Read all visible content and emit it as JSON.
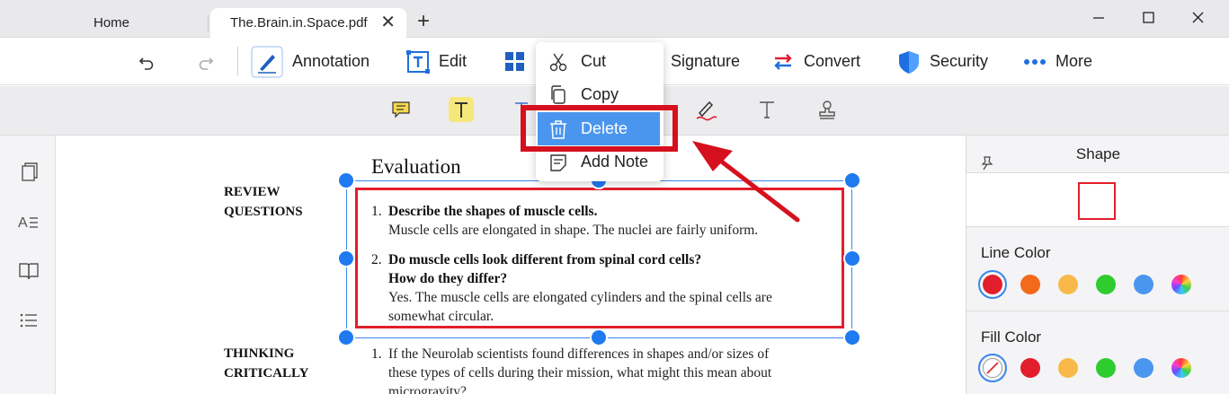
{
  "tabs": {
    "home": "Home",
    "active": "The.Brain.in.Space.pdf",
    "add": "+"
  },
  "window": {
    "minimize": "—",
    "maximize": "☐",
    "close": "✕"
  },
  "toolbar": {
    "undo_icon": "undo-icon",
    "redo_icon": "redo-icon",
    "annotation": "Annotation",
    "edit": "Edit",
    "signature": "Signature",
    "convert": "Convert",
    "security": "Security",
    "more": "More"
  },
  "subtoolbar": {
    "icons": [
      "comment-icon",
      "highlight-text-icon",
      "underline-icon",
      "pen-icon",
      "text-icon",
      "stamp-icon"
    ]
  },
  "context_menu": {
    "items": [
      {
        "label": "Cut",
        "icon": "scissors-icon"
      },
      {
        "label": "Copy",
        "icon": "copy-icon"
      },
      {
        "label": "Delete",
        "icon": "trash-icon"
      },
      {
        "label": "Add Note",
        "icon": "note-icon"
      }
    ],
    "active_item": "Delete"
  },
  "document": {
    "heading": "Evaluation",
    "section1": "REVIEW QUESTIONS",
    "section1_line1": "REVIEW",
    "section1_line2": "QUESTIONS",
    "section2_line1": "THINKING",
    "section2_line2": "CRITICALLY",
    "questions": [
      {
        "num": "1.",
        "q": "Describe the shapes of muscle cells.",
        "a": "Muscle cells are elongated in shape. The nuclei are fairly uniform."
      },
      {
        "num": "2.",
        "q1": "Do muscle cells look different from spinal cord cells?",
        "q2": "How do they differ?",
        "a1": "Yes. The muscle cells are elongated cylinders and the spinal cells are",
        "a2": "somewhat circular."
      }
    ],
    "thinking": {
      "num": "1.",
      "l1": "If the Neurolab scientists found differences in shapes and/or sizes of",
      "l2": "these types of cells during their mission, what might this mean about",
      "l3": "microgravity?"
    }
  },
  "panel": {
    "title": "Shape",
    "line_color_label": "Line Color",
    "fill_color_label": "Fill Color",
    "line_colors": [
      "#e21e2c",
      "#f26a1b",
      "#f9b94a",
      "#2ecc2e",
      "#4a96ee",
      "rainbow"
    ],
    "fill_colors": [
      "none",
      "#e21e2c",
      "#f9b94a",
      "#2ecc2e",
      "#4a96ee",
      "rainbow"
    ],
    "selected_line": "#e21e2c",
    "selected_fill": "none"
  },
  "colors": {
    "accent": "#1f7af0",
    "highlight": "#e21e2c",
    "menu_active": "#4a96ee"
  }
}
